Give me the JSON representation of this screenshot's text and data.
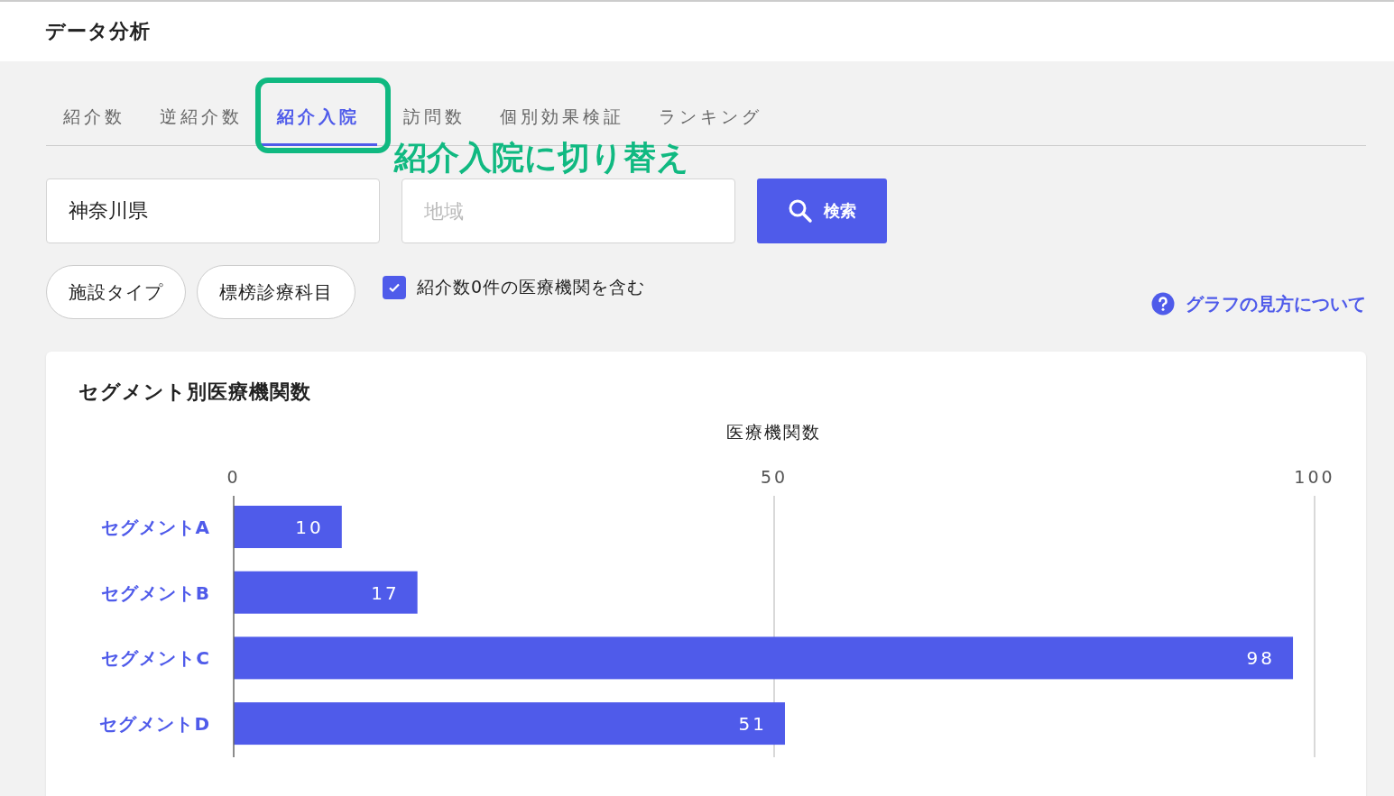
{
  "header": {
    "title": "データ分析"
  },
  "tabs": [
    {
      "label": "紹介数",
      "selected": false
    },
    {
      "label": "逆紹介数",
      "selected": false
    },
    {
      "label": "紹介入院",
      "selected": true
    },
    {
      "label": "訪問数",
      "selected": false
    },
    {
      "label": "個別効果検証",
      "selected": false
    },
    {
      "label": "ランキング",
      "selected": false
    }
  ],
  "annotation": {
    "text": "紹介入院に切り替え"
  },
  "filters": {
    "prefecture": {
      "value": "神奈川県"
    },
    "region": {
      "placeholder": "地域"
    },
    "search_button": "検索",
    "pills": [
      "施設タイプ",
      "標榜診療科目"
    ],
    "include_zero": {
      "label": "紹介数0件の医療機関を含む",
      "checked": true
    },
    "help_link": "グラフの見方について"
  },
  "card": {
    "title": "セグメント別医療機関数",
    "chart_data": {
      "type": "bar",
      "orientation": "horizontal",
      "xlabel": "医療機関数",
      "categories": [
        "セグメントA",
        "セグメントB",
        "セグメントC",
        "セグメントD"
      ],
      "series": [
        {
          "color": "#4f5bea",
          "values": [
            10,
            17,
            98,
            51
          ]
        }
      ],
      "xlim": [
        0,
        100
      ],
      "xticks": [
        0,
        50,
        100
      ],
      "data_labels": true
    }
  }
}
